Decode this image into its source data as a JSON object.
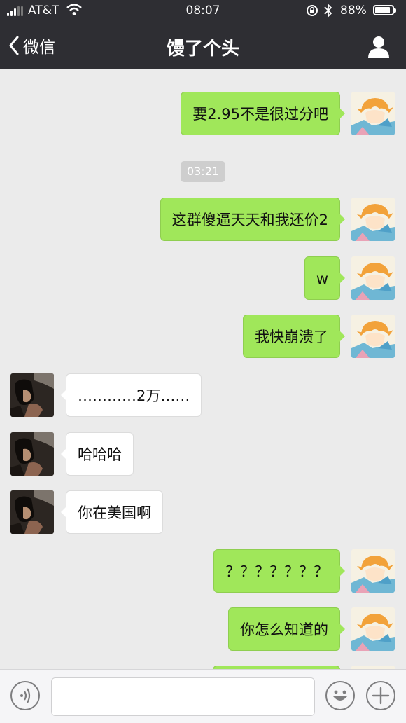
{
  "status_bar": {
    "carrier": "AT&T",
    "time": "08:07",
    "battery_percent": "88%",
    "battery_level": 0.88
  },
  "header": {
    "back_label": "微信",
    "title": "馒了个头"
  },
  "chat": {
    "timestamp": "03:21",
    "messages": [
      {
        "from": "me",
        "text": "要2.95不是很过分吧"
      },
      {
        "from": "me",
        "text": "这群傻逼天天和我还价2"
      },
      {
        "from": "me",
        "text": "w"
      },
      {
        "from": "me",
        "text": "我快崩溃了"
      },
      {
        "from": "them",
        "text": "…………2万……"
      },
      {
        "from": "them",
        "text": "哈哈哈"
      },
      {
        "from": "them",
        "text": "你在美国啊"
      },
      {
        "from": "me",
        "text": "？？？？？？？"
      },
      {
        "from": "me",
        "text": "你怎么知道的"
      }
    ]
  },
  "input": {
    "value": "",
    "placeholder": ""
  },
  "icons": {
    "back": "chevron-left-icon",
    "profile": "person-icon",
    "voice": "voice-icon",
    "emoji": "emoji-icon",
    "plus": "plus-icon"
  },
  "colors": {
    "header_bg": "#2e2e33",
    "chat_bg": "#ebebeb",
    "my_bubble": "#a0e75a",
    "their_bubble": "#ffffff"
  }
}
